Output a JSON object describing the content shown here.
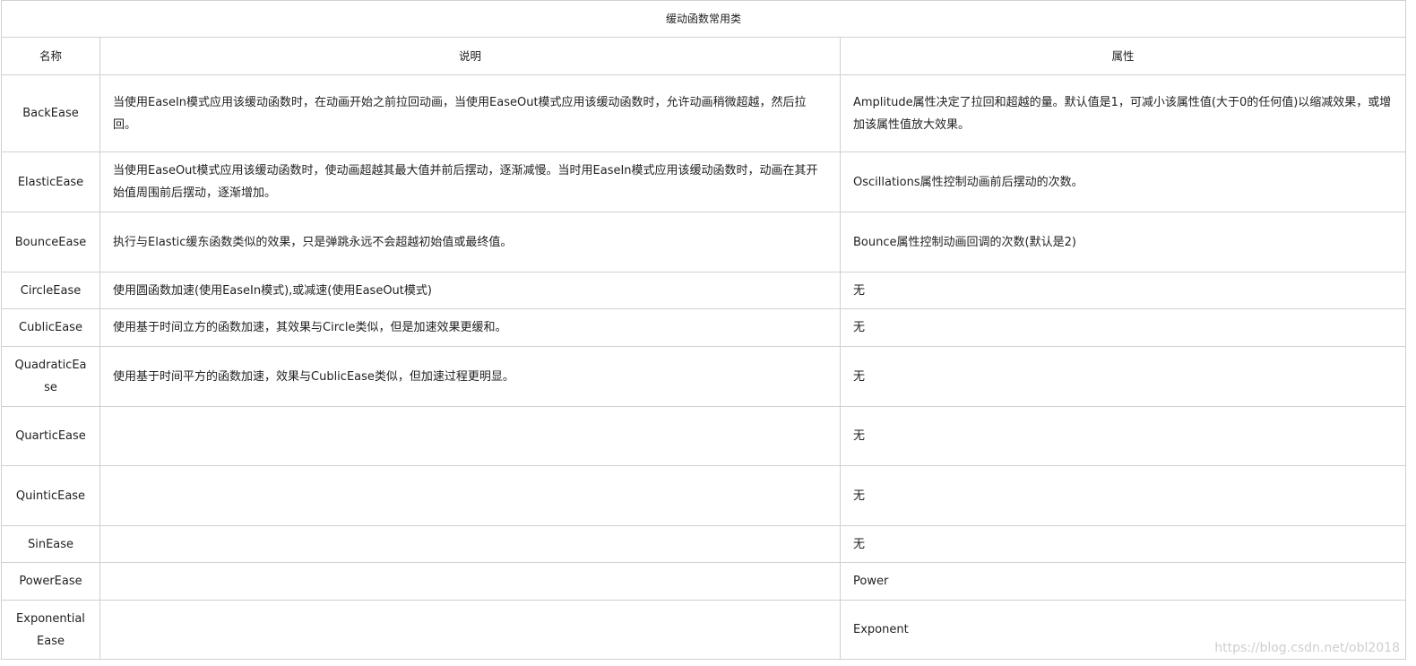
{
  "table": {
    "caption": "缓动函数常用类",
    "headers": {
      "name": "名称",
      "description": "说明",
      "property": "属性"
    },
    "rows": [
      {
        "name": "BackEase",
        "description": "当使用EaseIn模式应用该缓动函数时，在动画开始之前拉回动画，当使用EaseOut模式应用该缓动函数时，允许动画稍微超越，然后拉回。",
        "property": "Amplitude属性决定了拉回和超越的量。默认值是1，可减小该属性值(大于0的任何值)以缩减效果，或增加该属性值放大效果。"
      },
      {
        "name": "ElasticEase",
        "description": "当使用EaseOut模式应用该缓动函数时，使动画超越其最大值并前后摆动，逐渐减慢。当时用EaseIn模式应用该缓动函数时，动画在其开始值周围前后摆动，逐渐增加。",
        "property": "Oscillations属性控制动画前后摆动的次数。"
      },
      {
        "name": "BounceEase",
        "description": "执行与Elastic缓东函数类似的效果，只是弹跳永远不会超越初始值或最终值。",
        "property": "Bounce属性控制动画回调的次数(默认是2)"
      },
      {
        "name": "CircleEase",
        "description": "使用圆函数加速(使用EaseIn模式),或减速(使用EaseOut模式)",
        "property": "无"
      },
      {
        "name": "CublicEase",
        "description": "使用基于时间立方的函数加速，其效果与Circle类似，但是加速效果更缓和。",
        "property": "无"
      },
      {
        "name": "QuadraticEase",
        "description": "使用基于时间平方的函数加速，效果与CublicEase类似，但加速过程更明显。",
        "property": "无"
      },
      {
        "name": "QuarticEase",
        "description": "",
        "property": "无"
      },
      {
        "name": "QuinticEase",
        "description": "",
        "property": "无"
      },
      {
        "name": "SinEase",
        "description": "",
        "property": "无"
      },
      {
        "name": "PowerEase",
        "description": "",
        "property": "Power"
      },
      {
        "name": "ExponentialEase",
        "description": "",
        "property": "Exponent"
      }
    ]
  },
  "watermark": "https://blog.csdn.net/obl2018"
}
